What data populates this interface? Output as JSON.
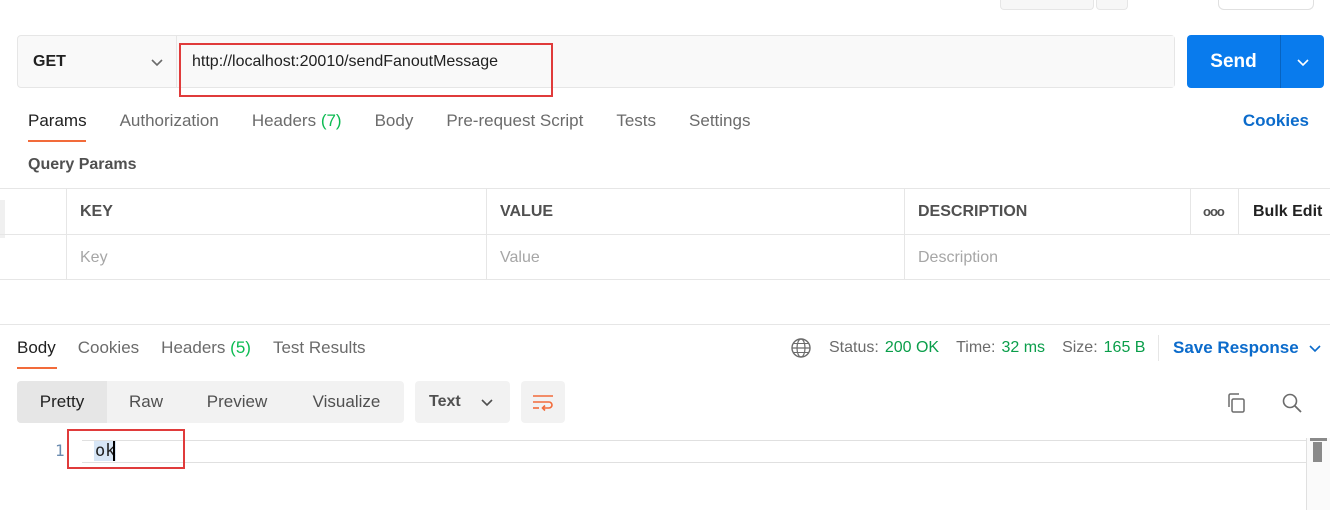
{
  "request": {
    "method": "GET",
    "url": "http://localhost:20010/sendFanoutMessage",
    "send_label": "Send"
  },
  "request_tabs": {
    "params": "Params",
    "authorization": "Authorization",
    "headers": "Headers",
    "headers_count": "(7)",
    "body": "Body",
    "prerequest": "Pre-request Script",
    "tests": "Tests",
    "settings": "Settings",
    "cookies": "Cookies"
  },
  "query_params": {
    "title": "Query Params",
    "columns": {
      "key": "KEY",
      "value": "VALUE",
      "description": "DESCRIPTION",
      "more": "ooo",
      "bulk_edit": "Bulk Edit"
    },
    "placeholders": {
      "key": "Key",
      "value": "Value",
      "description": "Description"
    }
  },
  "response_tabs": {
    "body": "Body",
    "cookies": "Cookies",
    "headers": "Headers",
    "headers_count": "(5)",
    "test_results": "Test Results"
  },
  "status": {
    "status_label": "Status:",
    "status_value": "200 OK",
    "time_label": "Time:",
    "time_value": "32 ms",
    "size_label": "Size:",
    "size_value": "165 B",
    "save_response": "Save Response"
  },
  "view": {
    "pretty": "Pretty",
    "raw": "Raw",
    "preview": "Preview",
    "visualize": "Visualize",
    "format": "Text"
  },
  "code": {
    "line_number": "1",
    "content": "ok"
  },
  "colors": {
    "send_blue": "#097bed",
    "tab_accent": "#f26b3a",
    "link_blue": "#0b6bcb",
    "status_green": "#0a9e4a",
    "annotation_red": "#e03b3b"
  },
  "icons": [
    "chevron-down-icon",
    "globe-icon",
    "wrap-lines-icon",
    "copy-icon",
    "search-icon"
  ]
}
